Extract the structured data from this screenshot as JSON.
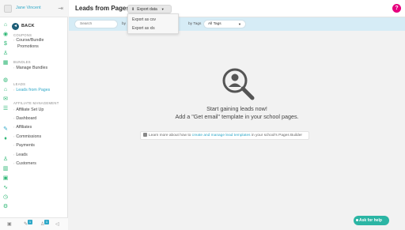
{
  "user": {
    "name": "Jane Vincent"
  },
  "sidebar": {
    "back_label": "BACK",
    "sections": [
      {
        "title": "COUPONS",
        "items": [
          "Course/Bundle",
          "Promotions"
        ]
      },
      {
        "title": "BUNDLES",
        "items": [
          "Manage Bundles"
        ]
      },
      {
        "title": "LEADS",
        "items": [
          "Leads from Pages"
        ]
      },
      {
        "title": "AFFILIATE MANAGEMENT",
        "items": [
          "Affiliate Set Up",
          "Dashboard",
          "Affiliates",
          "Commissions",
          "Payments",
          "Leads",
          "Customers"
        ]
      }
    ],
    "active_item": "Leads from Pages",
    "footer_badges": [
      "1",
      "1"
    ]
  },
  "header": {
    "title": "Leads from Pages",
    "export_label": "Export data",
    "help_icon": "help-icon"
  },
  "export_menu": [
    "Export as csv",
    "Export as xls"
  ],
  "filters": {
    "search_placeholder": "Search",
    "by_label_1": "by",
    "by_tags_label": "by Tags",
    "tags_value": "All Tags"
  },
  "empty_state": {
    "title": "Start gaining leads now!",
    "subtitle": "Add a \"Get email\" template in your school pages.",
    "learn_prefix": "Learn more about how to ",
    "learn_link": "create and manage lead templates",
    "learn_suffix": " in your school's Pages Builder"
  },
  "ask_help": "Ask for help",
  "colors": {
    "accent": "#2fa8c8",
    "help": "#e6007e",
    "green": "#2bb673",
    "filterbar": "#d6ecf6",
    "ask_help": "#2bb5a4"
  }
}
